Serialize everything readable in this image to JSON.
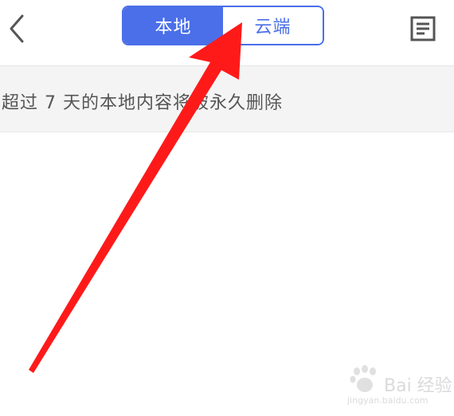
{
  "header": {
    "tabs": [
      {
        "label": "本地",
        "active": true
      },
      {
        "label": "云端",
        "active": false
      }
    ]
  },
  "notice": {
    "text": "超过 7 天的本地内容将被永久删除"
  },
  "watermark": {
    "brand": "Bai 经验",
    "site": "jingyan.baidu.com"
  },
  "colors": {
    "accent": "#4a6fe8",
    "arrow": "#ff1a1a",
    "notice_bg": "#f4f4f4"
  }
}
